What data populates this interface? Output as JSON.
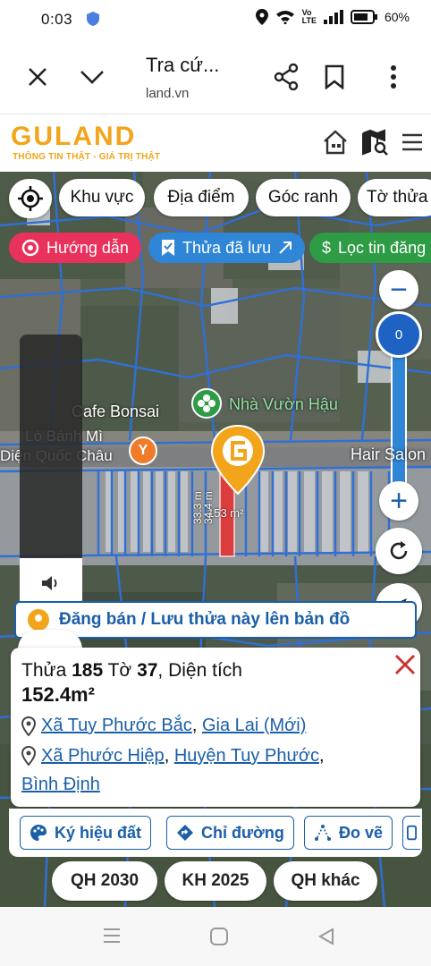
{
  "status_bar": {
    "time": "0:03",
    "battery": "60%"
  },
  "browser": {
    "title": "Tra cứ...",
    "url": "land.vn",
    "close_icon": "close-icon",
    "menu_icon": "chevron-down-icon"
  },
  "app": {
    "logo": "GULAND",
    "slogan": "THÔNG TIN THẬT - GIÁ TRỊ THẬT"
  },
  "filters": {
    "items": [
      "Khu vực",
      "Địa điểm",
      "Góc ranh",
      "Tờ thửa"
    ]
  },
  "chips": {
    "guide": "Hướng dẫn",
    "saved": "Thửa đã lưu",
    "filter": "Lọc tin đăng"
  },
  "zoom": {
    "minus": "−",
    "level": "0",
    "plus": "+"
  },
  "map_labels": {
    "cafe": "Cafe Bonsai",
    "garden": "Nhà Vườn Hậu",
    "bakery": "Lò Bánh Mì",
    "bakery2": "Diện Quốc Châu",
    "salon": "Hair Salon",
    "area": "153 m²",
    "dim1": "33.3 m",
    "dim2": "34.4 m"
  },
  "banner": {
    "text": "Đăng bán / Lưu thửa này lên bản đồ"
  },
  "info": {
    "parcel_prefix": "Thửa",
    "parcel_no": "185",
    "sheet_prefix": "Tờ",
    "sheet_no": "37",
    "area_label": ", Diện tích",
    "area_value": "152.4m²",
    "addr1_a": "Xã Tuy Phước Bắc",
    "addr1_b": "Gia Lai (Mới)",
    "addr2_a": "Xã Phước Hiệp",
    "addr2_b": "Huyện Tuy Phước",
    "addr2_c": "Bình Định"
  },
  "tools": {
    "symbols": "Ký hiệu đất",
    "directions": "Chỉ đường",
    "measure": "Đo vẽ"
  },
  "plans": {
    "qh2030": "QH 2030",
    "kh2025": "KH 2025",
    "qhother": "QH khác"
  },
  "more": "...",
  "colors": {
    "brand": "#f2a51a",
    "link": "#1a5fa8",
    "guide_chip": "#e8315b",
    "saved_chip": "#2f86d6",
    "filter_chip": "#2e9b45",
    "parcel": "#e03a3a",
    "boundary": "#2f6fd6"
  }
}
